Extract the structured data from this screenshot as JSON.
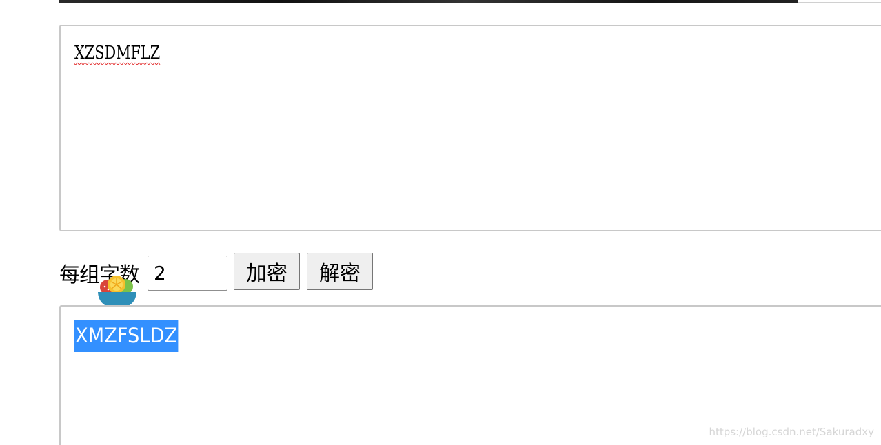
{
  "input": {
    "value": "XZSDMFLZ"
  },
  "controls": {
    "group_label": "每组字数",
    "group_value": "2",
    "encrypt_label": "加密",
    "decrypt_label": "解密"
  },
  "output": {
    "value": "XMZFSLDZ"
  },
  "watermark": "https://blog.csdn.net/Sakuradxy",
  "icons": {
    "decoration": "fruit-bowl-icon"
  },
  "colors": {
    "selection": "#3390ff",
    "spellcheck_underline": "#e02020"
  }
}
